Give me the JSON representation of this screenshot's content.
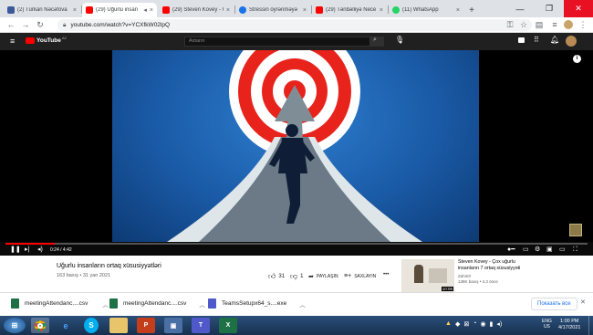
{
  "browser": {
    "tabs": [
      {
        "title": "(2) Türkan Nəcəfova",
        "favicon_color": "#3b5998"
      },
      {
        "title": "(29) Uğurlu insan",
        "favicon_color": "#ff0000",
        "active": true
      },
      {
        "title": "(29) Steven Kovey - Ç",
        "favicon_color": "#ff0000"
      },
      {
        "title": "Stressin öyrənməyə",
        "favicon_color": "#1a73e8"
      },
      {
        "title": "(29) Tənbəlliyə Nece",
        "favicon_color": "#ff0000"
      },
      {
        "title": "(11) WhatsApp",
        "favicon_color": "#25d366"
      }
    ],
    "new_tab_label": "+",
    "url": "youtube.com/watch?v=YCXfkW02lpQ",
    "window_controls": {
      "minimize": "—",
      "restore": "❐",
      "close": "✕"
    }
  },
  "youtube": {
    "logo": "YouTube",
    "logo_region": "AZ",
    "search_placeholder": "Axtarın",
    "player": {
      "time_current": "0:24",
      "time_total": "4:42",
      "time_display": "0:24 / 4:42",
      "progress_fraction": 0.085
    },
    "video": {
      "title": "Uğurlu insanların ortaq xüsusiyyətləri",
      "meta": "163 baxış • 31 yan 2021",
      "likes": "31",
      "dislikes": "1",
      "share_label": "PAYLAŞIN",
      "save_label": "SAXLAYIN",
      "more_label": "•••"
    },
    "suggestion": {
      "title_line1": "Steven Kovey - Çox uğurlu",
      "title_line2": "insanların 7 ortaq xüsusiyyəti",
      "channel": "Zahir0l",
      "meta": "138K baxış • 4.3 önce",
      "duration": "10:06"
    }
  },
  "downloads": {
    "items": [
      {
        "name": "meetingAttendanc....csv",
        "icon_color": "#1e7145"
      },
      {
        "name": "meetingAttendanc....csv",
        "icon_color": "#1e7145"
      },
      {
        "name": "TeamsSetupx64_s....exe",
        "icon_color": "#5059c9"
      }
    ],
    "show_all_label": "Показать все",
    "close_label": "✕"
  },
  "taskbar": {
    "language": "ENG",
    "locale": "US",
    "time": "1:00 PM",
    "date": "4/17/2021"
  },
  "colors": {
    "youtube_red": "#ff0000",
    "youtube_dark": "#202020",
    "tabstrip": "#dee1e6"
  }
}
